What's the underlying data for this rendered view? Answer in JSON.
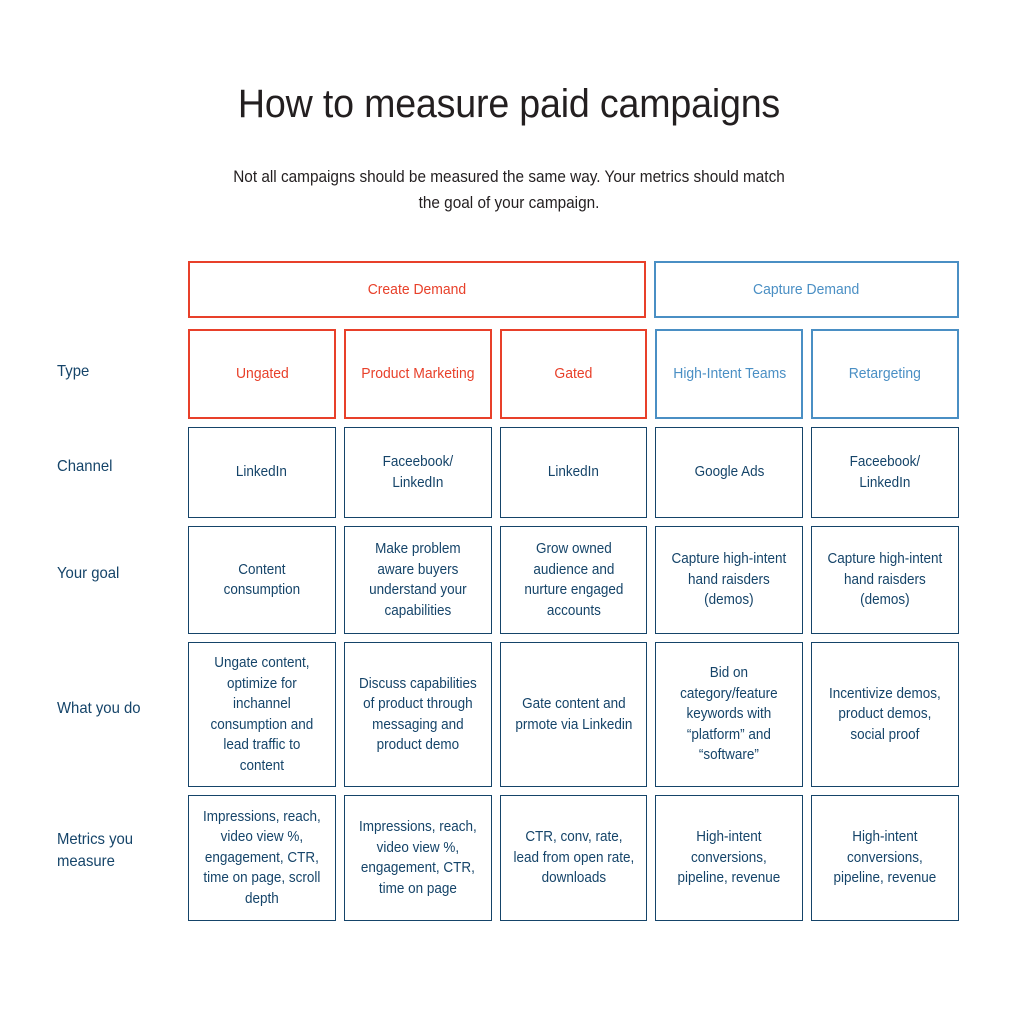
{
  "header": {
    "title": "How to measure paid campaigns",
    "subtitle": "Not all campaigns should be measured the same way. Your metrics should match the goal of your campaign."
  },
  "colors": {
    "create_demand": "#e8402a",
    "capture_demand": "#4a8fc4",
    "body_navy": "#154469",
    "title_black": "#231f20",
    "background": "#ffffff"
  },
  "demand_groups": [
    {
      "label": "Create Demand",
      "span": 3,
      "color": "#e8402a"
    },
    {
      "label": "Capture Demand",
      "span": 2,
      "color": "#4a8fc4"
    }
  ],
  "row_labels": {
    "type": "Type",
    "channel": "Channel",
    "goal": "Your goal",
    "whatyoudo": "What you do",
    "metrics": "Metrics you measure"
  },
  "columns": [
    {
      "type": "Ungated",
      "group": "Create Demand",
      "channel": "LinkedIn",
      "goal": "Content consumption",
      "whatyoudo": "Ungate content, optimize for inchannel consumption and lead traffic to content",
      "metrics": "Impressions, reach, video view %, engagement, CTR, time on page, scroll depth"
    },
    {
      "type": "Product Marketing",
      "group": "Create Demand",
      "channel": "Faceebook/ LinkedIn",
      "goal": "Make problem aware buyers understand your capabilities",
      "whatyoudo": "Discuss capabilities of product through messaging and product demo",
      "metrics": "Impressions, reach, video view %, engagement, CTR, time on page"
    },
    {
      "type": "Gated",
      "group": "Create Demand",
      "channel": "LinkedIn",
      "goal": "Grow owned audience and nurture engaged accounts",
      "whatyoudo": "Gate content and prmote via Linkedin",
      "metrics": "CTR, conv, rate, lead from open rate, downloads"
    },
    {
      "type": "High-Intent Teams",
      "group": "Capture Demand",
      "channel": "Google Ads",
      "goal": "Capture high-intent hand raisders (demos)",
      "whatyoudo": "Bid on category/feature keywords with “platform” and “software”",
      "metrics": "High-intent conversions, pipeline, revenue"
    },
    {
      "type": "Retargeting",
      "group": "Capture Demand",
      "channel": "Faceebook/ LinkedIn",
      "goal": "Capture high-intent hand raisders (demos)",
      "whatyoudo": "Incentivize demos, product demos, social proof",
      "metrics": "High-intent conversions, pipeline, revenue"
    }
  ]
}
